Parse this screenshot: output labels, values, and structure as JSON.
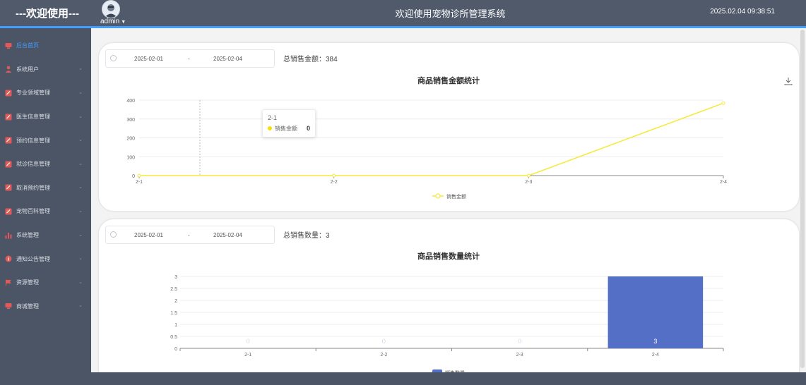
{
  "header": {
    "brand": "---欢迎使用---",
    "username": "admin",
    "title": "欢迎使用宠物诊所管理系统",
    "datetime": "2025.02.04 09:38:51"
  },
  "sidebar": {
    "items": [
      {
        "label": "后台首页",
        "icon": "monitor-icon",
        "active": true,
        "expandable": false
      },
      {
        "label": "系统用户",
        "icon": "user-icon",
        "active": false,
        "expandable": true
      },
      {
        "label": "专业领域管理",
        "icon": "edit-icon",
        "active": false,
        "expandable": true
      },
      {
        "label": "医生信息管理",
        "icon": "edit-icon",
        "active": false,
        "expandable": true
      },
      {
        "label": "预约信息管理",
        "icon": "edit-icon",
        "active": false,
        "expandable": true
      },
      {
        "label": "就诊信息管理",
        "icon": "edit-icon",
        "active": false,
        "expandable": true
      },
      {
        "label": "取消预约管理",
        "icon": "edit-icon",
        "active": false,
        "expandable": true
      },
      {
        "label": "宠物百科管理",
        "icon": "edit-icon",
        "active": false,
        "expandable": true
      },
      {
        "label": "系统管理",
        "icon": "bar-chart-icon",
        "active": false,
        "expandable": true
      },
      {
        "label": "通知公告管理",
        "icon": "info-icon",
        "active": false,
        "expandable": true
      },
      {
        "label": "资源管理",
        "icon": "flag-icon",
        "active": false,
        "expandable": true
      },
      {
        "label": "商城管理",
        "icon": "monitor-icon",
        "active": false,
        "expandable": true
      }
    ]
  },
  "amount_panel": {
    "start_date": "2025-02-01",
    "separator": "-",
    "end_date": "2025-02-04",
    "total_label": "总销售金额：",
    "total_value": "384",
    "tooltip": {
      "title": "2-1",
      "series": "销售金额",
      "value": "0"
    }
  },
  "quantity_panel": {
    "start_date": "2025-02-01",
    "separator": "-",
    "end_date": "2025-02-04",
    "total_label": "总销售数量：",
    "total_value": "3"
  },
  "chart_data": [
    {
      "type": "line",
      "title": "商品销售金额统计",
      "categories": [
        "2-1",
        "2-2",
        "2-3",
        "2-4"
      ],
      "series": [
        {
          "name": "销售金额",
          "values": [
            0,
            0,
            0,
            384
          ]
        }
      ],
      "ylim": [
        0,
        400
      ],
      "yticks": [
        "0",
        "100",
        "200",
        "300",
        "400"
      ],
      "grid": true,
      "legend": "bottom",
      "color": "#f5e93b"
    },
    {
      "type": "bar",
      "title": "商品销售数量统计",
      "categories": [
        "2-1",
        "2-2",
        "2-3",
        "2-4"
      ],
      "series": [
        {
          "name": "销售数量",
          "values": [
            0,
            0,
            0,
            3
          ]
        }
      ],
      "data_labels": [
        "0",
        "0",
        "0",
        "3"
      ],
      "ylim": [
        0,
        3
      ],
      "yticks": [
        "0",
        "0.5",
        "1",
        "1.5",
        "2",
        "2.5",
        "3"
      ],
      "grid": true,
      "legend": "bottom",
      "color": "#5470c6"
    }
  ]
}
